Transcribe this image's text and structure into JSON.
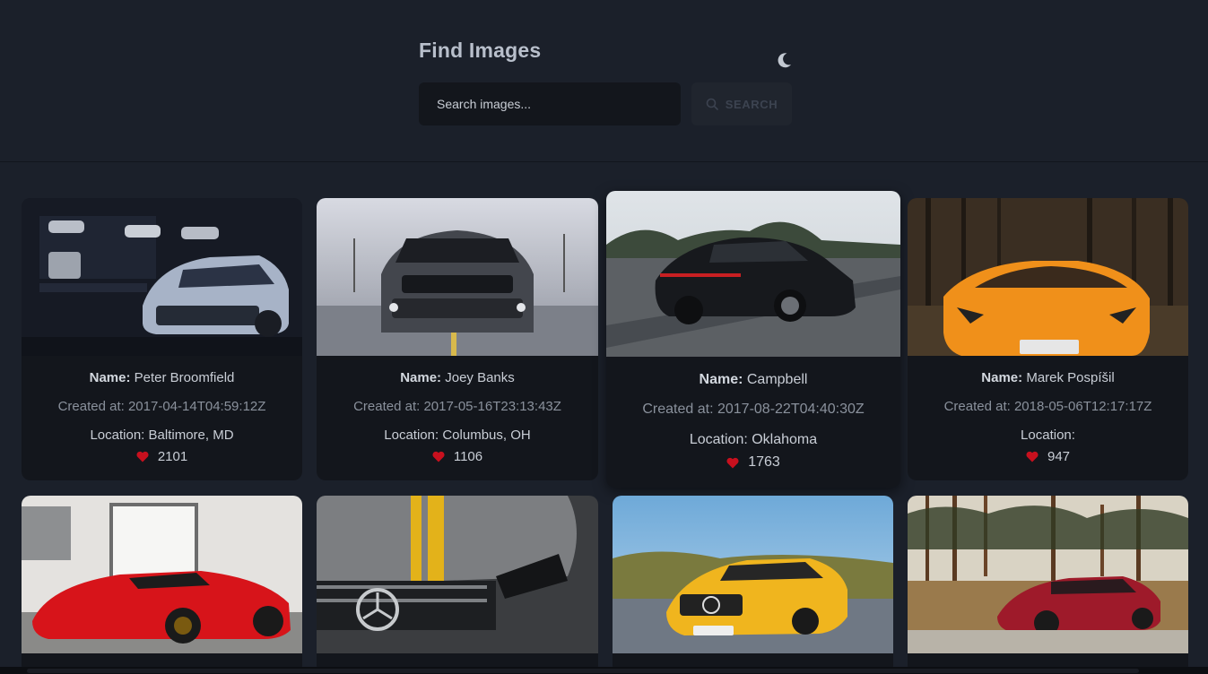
{
  "header": {
    "title": "Find Images",
    "theme_toggle_icon": "moon-icon",
    "search": {
      "placeholder": "Search images...",
      "value": "",
      "button_label": "SEARCH",
      "button_icon": "search-icon"
    }
  },
  "labels": {
    "name": "Name:",
    "created": "Created at:",
    "location": "Location:"
  },
  "colors": {
    "background": "#1b202a",
    "card": "#13161c",
    "heart": "#c8101e",
    "title": "#b8bfcb"
  },
  "cards": [
    {
      "name": "Peter Broomfield",
      "created_at": "2017-04-14T04:59:12Z",
      "location": "Baltimore, MD",
      "likes": "2101",
      "photo": "gray sports car in garage"
    },
    {
      "name": "Joey Banks",
      "created_at": "2017-05-16T23:13:43Z",
      "location": "Columbus, OH",
      "likes": "1106",
      "photo": "dark muscle car front view"
    },
    {
      "name": "Campbell",
      "created_at": "2017-08-22T04:40:30Z",
      "location": "Oklahoma",
      "likes": "1763",
      "photo": "black sedan on road"
    },
    {
      "name": "Marek Pospíšil",
      "created_at": "2018-05-06T12:17:17Z",
      "location": "",
      "likes": "947",
      "photo": "orange supercar in forest"
    },
    {
      "photo": "red hypercar in showroom"
    },
    {
      "photo": "gray sports car with yellow stripe"
    },
    {
      "photo": "yellow coupe on road"
    },
    {
      "photo": "red coupe in pine forest"
    }
  ]
}
